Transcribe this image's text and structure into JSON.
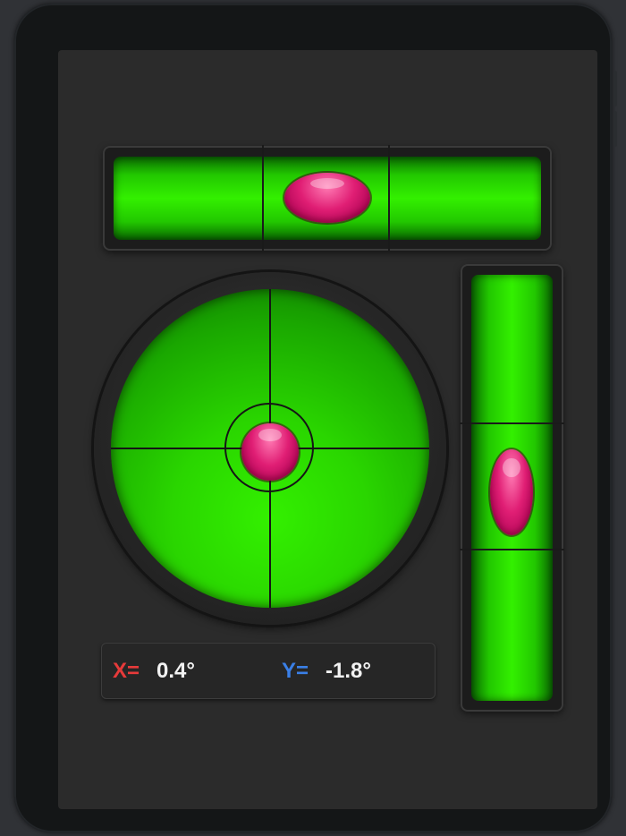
{
  "app": {
    "title": ""
  },
  "readout": {
    "x_label": "X=",
    "x_value": "0.4°",
    "y_label": "Y=",
    "y_value": "-1.8°"
  },
  "tilt": {
    "x_degrees": 0.4,
    "y_degrees": -1.8
  },
  "colors": {
    "background": "#2b2b2b",
    "vial_green": "#33f000",
    "bubble_pink": "#e01e74",
    "x_label": "#e63a3a",
    "y_label": "#3a7fe6",
    "value_text": "#f2f2f2"
  },
  "icons": {
    "horizontal_level": "horizontal-vial-icon",
    "vertical_level": "vertical-vial-icon",
    "circular_level": "bullseye-level-icon"
  }
}
